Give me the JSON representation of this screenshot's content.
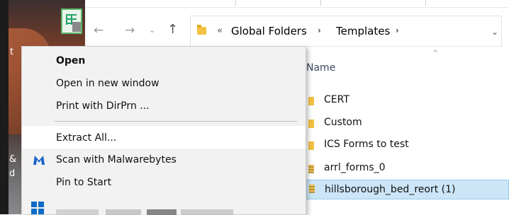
{
  "desktop": {
    "text_t": "t",
    "text_amp": "&",
    "text_d": "d"
  },
  "navigation": {
    "back_glyph": "←",
    "forward_glyph": "→",
    "recent_glyph": "⌄",
    "up_glyph": "↑"
  },
  "address_bar": {
    "chevrons": "«",
    "segments": [
      "Global Folders",
      "Templates"
    ],
    "separator": "›",
    "dropdown_glyph": "⌄"
  },
  "file_list": {
    "sort_glyph": "^",
    "column_name": "Name",
    "items": [
      {
        "name": "CERT",
        "type": "folder"
      },
      {
        "name": "Custom",
        "type": "folder"
      },
      {
        "name": "ICS Forms to test",
        "type": "folder"
      },
      {
        "name": "arrl_forms_0",
        "type": "zip"
      },
      {
        "name": "hillsborough_bed_reort (1)",
        "type": "zip",
        "selected": true
      }
    ]
  },
  "context_menu": {
    "open": "Open",
    "open_new_window": "Open in new window",
    "print_with": "Print with DirPrn ...",
    "extract_all": "Extract All...",
    "scan": "Scan with Malwarebytes",
    "pin_to_start": "Pin to Start"
  },
  "colors": {
    "selection": "#cce6f8",
    "menu_background": "#f2f2f2",
    "folder": "#f3c243",
    "malwarebytes": "#1a62c7"
  }
}
